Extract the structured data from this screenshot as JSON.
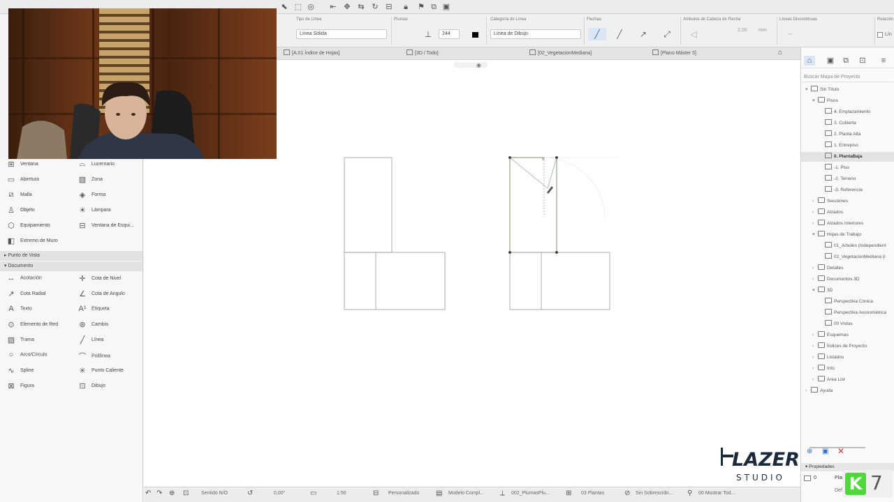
{
  "colors": {
    "accent": "#2a6fc9",
    "selection": "#e3e3e3",
    "logo": "#1b2a3a",
    "badge_green": "#4fd83a"
  },
  "infobox": {
    "line_type_label": "Tipo de Línea",
    "line_type_value": "Línea Sólida",
    "pen_label": "Plumas",
    "pen_value": "244",
    "line_category_label": "Categoría de Línea",
    "line_category_value": "Línea de Dibujo",
    "arrows_label": "Flechas",
    "arrowhead_attrs_label": "Atributos de Cabeza de Flecha",
    "arrow_size": "2,00",
    "arrow_unit": "mm",
    "dashed_lines_label": "Líneas Discontinuas",
    "relation_label": "Relación",
    "relation_option": "Lín"
  },
  "tabs": [
    {
      "label": "[A.01 Índice de Hojas]"
    },
    {
      "label": "[3D / Todo]"
    },
    {
      "label": "[02_VegetacionMediana]"
    },
    {
      "label": "[Plano Máster 5]"
    }
  ],
  "toolbox": {
    "tools_top": [
      {
        "left": "Ventana",
        "left_icon": "window-icon",
        "right": "Lucernario",
        "right_icon": "skylight-icon"
      },
      {
        "left": "Abertura",
        "left_icon": "opening-icon",
        "right": "Zona",
        "right_icon": "zone-icon"
      },
      {
        "left": "Malla",
        "left_icon": "mesh-icon",
        "right": "Forma",
        "right_icon": "morph-icon"
      },
      {
        "left": "Objeto",
        "left_icon": "object-icon",
        "right": "Lámpara",
        "right_icon": "lamp-icon"
      },
      {
        "left": "Equipamiento",
        "left_icon": "equipment-icon",
        "right": "Ventana de Esqui...",
        "right_icon": "corner-window-icon"
      },
      {
        "left": "Extremo de Muro",
        "left_icon": "wall-end-icon",
        "right": "",
        "right_icon": ""
      }
    ],
    "section_viewpoint": "Punto de Vista",
    "section_document": "Documento",
    "tools_doc": [
      {
        "left": "Acotación",
        "right": "Cota de Nivel"
      },
      {
        "left": "Cota Radial",
        "right": "Cota de Angulo"
      },
      {
        "left": "Texto",
        "right": "Etiqueta"
      },
      {
        "left": "Elemento de Red",
        "right": "Cambio"
      },
      {
        "left": "Trama",
        "right": "Línea"
      },
      {
        "left": "Arco/Círculo",
        "right": "Polilínea"
      },
      {
        "left": "Spline",
        "right": "Punto Caliente"
      },
      {
        "left": "Figura",
        "right": "Dibujo"
      }
    ]
  },
  "navigator": {
    "search_placeholder": "Buscar Mapa de Proyecto",
    "tree": [
      {
        "label": "Sin Título",
        "level": 0,
        "expanded": true
      },
      {
        "label": "Pisos",
        "level": 1,
        "expanded": true
      },
      {
        "label": "4. Emplazamiento",
        "level": 2
      },
      {
        "label": "3. Cubierta",
        "level": 2
      },
      {
        "label": "2. Planta Alta",
        "level": 2
      },
      {
        "label": "1. Entrepiso",
        "level": 2
      },
      {
        "label": "0. PlantaBaja",
        "level": 2,
        "selected": true
      },
      {
        "label": "-1. Piso",
        "level": 2
      },
      {
        "label": "-2. Terreno",
        "level": 2
      },
      {
        "label": "-3. Referencia",
        "level": 2
      },
      {
        "label": "Secciones",
        "level": 1
      },
      {
        "label": "Alzados",
        "level": 1
      },
      {
        "label": "Alzados Interiores",
        "level": 1
      },
      {
        "label": "Hojas de Trabajo",
        "level": 1,
        "expanded": true
      },
      {
        "label": "01_Arboles (Independient",
        "level": 2
      },
      {
        "label": "02_VegetacionMediana (I",
        "level": 2
      },
      {
        "label": "Detalles",
        "level": 1
      },
      {
        "label": "Documentos 3D",
        "level": 1
      },
      {
        "label": "3D",
        "level": 1,
        "expanded": true
      },
      {
        "label": "Perspectiva Cónica",
        "level": 2
      },
      {
        "label": "Perspectiva Axonométrica",
        "level": 2
      },
      {
        "label": "00 Vistas",
        "level": 2
      },
      {
        "label": "Esquemas",
        "level": 1
      },
      {
        "label": "Índices de Proyecto",
        "level": 1
      },
      {
        "label": "Listados",
        "level": 1
      },
      {
        "label": "Info",
        "level": 1
      },
      {
        "label": "Area List",
        "level": 1
      },
      {
        "label": "Ayuda",
        "level": 0
      }
    ],
    "properties_label": "Propiedades",
    "prop_value": "0",
    "prop_name": "Plan",
    "prop_def": "Define"
  },
  "statusbar": {
    "zoom_label": "Sentido N/O",
    "angle": "0,00°",
    "scale": "1:50",
    "custom": "Personalizado",
    "model": "Modelo Compl...",
    "pen_set": "002_PlumasPlu...",
    "floors": "03 Plantas",
    "override": "Sin Sobrescribi...",
    "show": "00 Mostrar Tod..."
  },
  "logo": {
    "word": "LAZER",
    "sub": "STUDIO"
  },
  "badge": {
    "number": "7"
  }
}
